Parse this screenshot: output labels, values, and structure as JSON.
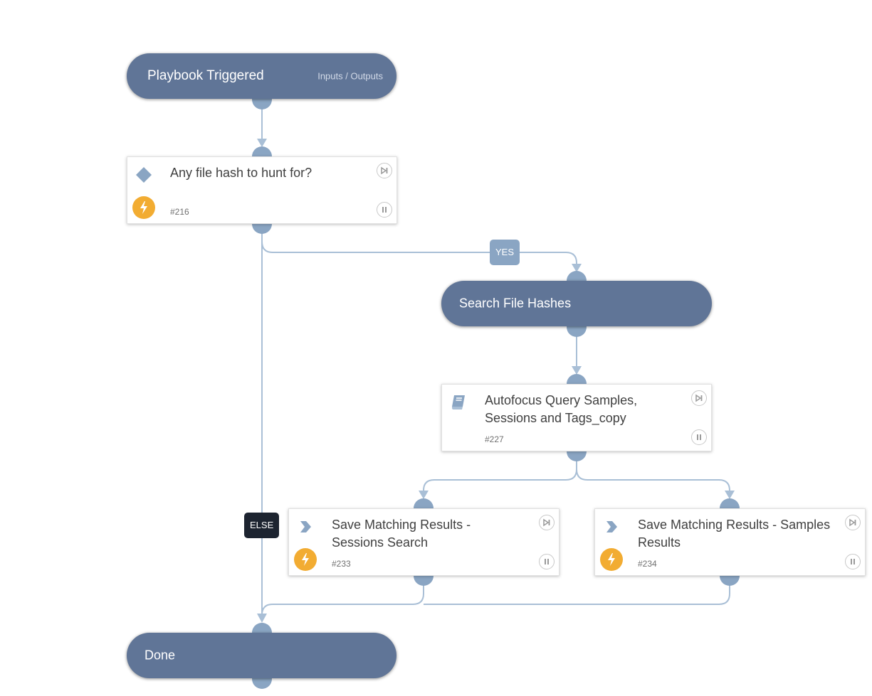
{
  "colors": {
    "section_pill": "#607597",
    "port": "#8aa5c3",
    "edge": "#a9bfd6",
    "automation_badge": "#f2ac32",
    "yes_label_bg": "#8aa5c3",
    "else_label_bg": "#1d2430"
  },
  "nodes": {
    "start": {
      "title": "Playbook Triggered",
      "io_link": "Inputs / Outputs"
    },
    "condition_216": {
      "name": "Any file hash to hunt for?",
      "id": "#216",
      "type_icon": "diamond-icon",
      "automated": true
    },
    "section_search": {
      "title": "Search File Hashes"
    },
    "subplaybook_227": {
      "name": "Autofocus Query Samples, Sessions and Tags_copy",
      "id": "#227",
      "type_icon": "book-icon",
      "automated": false
    },
    "task_233": {
      "name": "Save Matching Results - Sessions Search",
      "id": "#233",
      "type_icon": "chevron-right-icon",
      "automated": true
    },
    "task_234": {
      "name": "Save Matching Results - Samples Results",
      "id": "#234",
      "type_icon": "chevron-right-icon",
      "automated": true
    },
    "done": {
      "title": "Done"
    }
  },
  "edges": {
    "yes_label": "YES",
    "else_label": "ELSE"
  }
}
